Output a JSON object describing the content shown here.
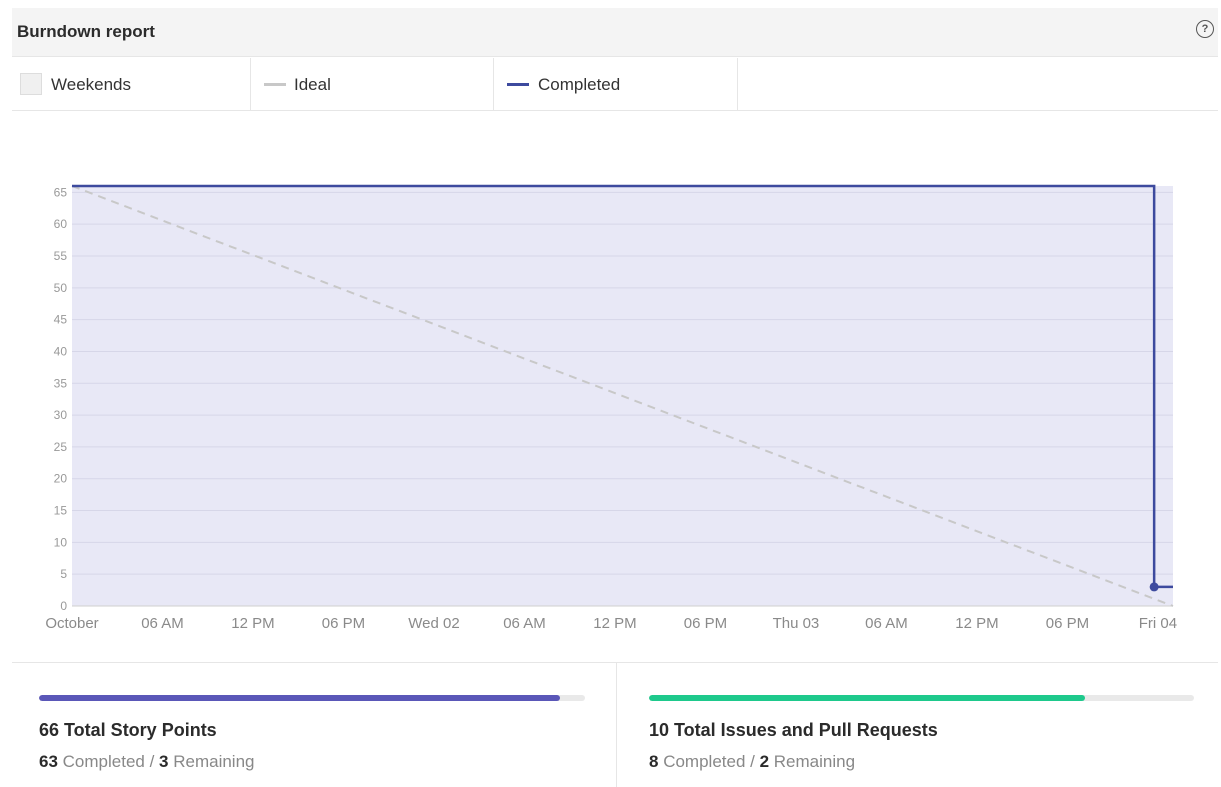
{
  "header": {
    "title": "Burndown report"
  },
  "legend": {
    "weekends": "Weekends",
    "ideal": "Ideal",
    "completed": "Completed"
  },
  "colors": {
    "completed": "#3d4a9e",
    "ideal": "#c8c8c8",
    "area": "#e8e8f6",
    "story_bar": "#5a57b8",
    "issues_bar": "#1ec98c"
  },
  "chart_data": {
    "type": "line",
    "title": "",
    "ylim": [
      0,
      66
    ],
    "yticks": [
      0,
      5,
      10,
      15,
      20,
      25,
      30,
      35,
      40,
      45,
      50,
      55,
      60,
      65
    ],
    "xtick_labels": [
      "October",
      "06 AM",
      "12 PM",
      "06 PM",
      "Wed 02",
      "06 AM",
      "12 PM",
      "06 PM",
      "Thu 03",
      "06 AM",
      "12 PM",
      "06 PM",
      "Fri 04"
    ],
    "x_range_hours": [
      0,
      73
    ],
    "series": [
      {
        "name": "Ideal",
        "style": "dashed",
        "points": [
          [
            0,
            66
          ],
          [
            73,
            0
          ]
        ]
      },
      {
        "name": "Completed",
        "style": "step",
        "points": [
          [
            0,
            66
          ],
          [
            71.75,
            66
          ],
          [
            71.75,
            3
          ],
          [
            73,
            3
          ]
        ]
      }
    ]
  },
  "stats": {
    "story": {
      "total_label": "66 Total Story Points",
      "completed_value": "63",
      "completed_text": " Completed / ",
      "remaining_value": "3",
      "remaining_text": " Remaining",
      "progress": 0.955
    },
    "issues": {
      "total_label": "10 Total Issues and Pull Requests",
      "completed_value": "8",
      "completed_text": " Completed / ",
      "remaining_value": "2",
      "remaining_text": " Remaining",
      "progress": 0.8
    }
  }
}
